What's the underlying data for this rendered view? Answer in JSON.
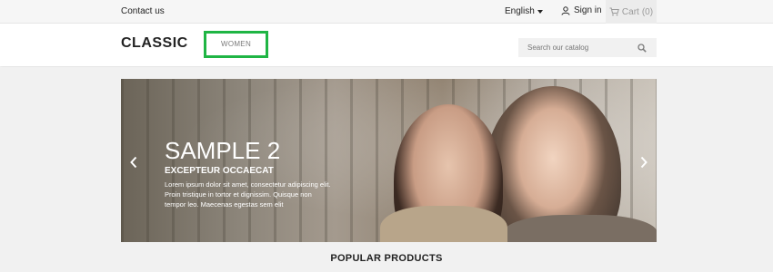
{
  "topbar": {
    "contact_label": "Contact us",
    "language_label": "English",
    "signin_label": "Sign in",
    "cart_label": "Cart",
    "cart_count": "(0)"
  },
  "header": {
    "logo": "CLASSIC",
    "nav_women_label": "WOMEN",
    "search_placeholder": "Search our catalog"
  },
  "slider": {
    "title": "SAMPLE 2",
    "subtitle": "EXCEPTEUR OCCAECAT",
    "text": "Lorem ipsum dolor sit amet, consectetur adipiscing elit. Proin tristique in tortor et dignissim. Quisque non tempor leo. Maecenas egestas sem elit"
  },
  "main": {
    "section_title": "POPULAR PRODUCTS"
  },
  "colors": {
    "highlight_border": "#1fb544",
    "text_dark": "#232323"
  }
}
